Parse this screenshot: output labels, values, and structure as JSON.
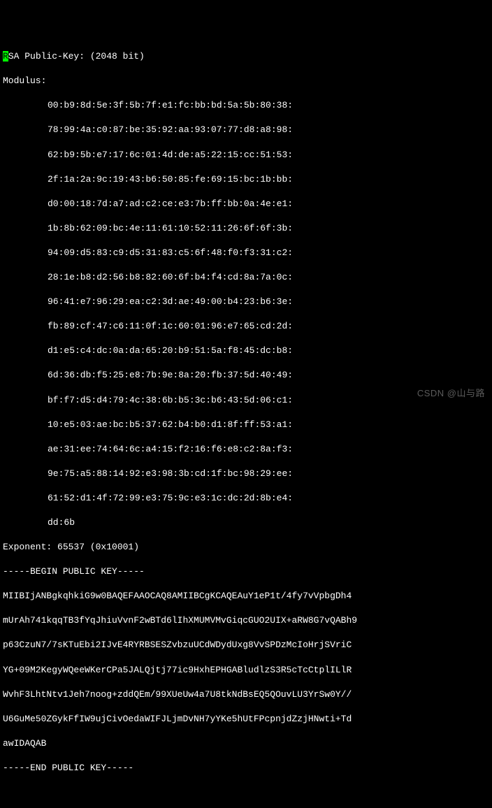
{
  "header": {
    "algo_first_char": "R",
    "algo_rest": "SA Public-Key: (2048 bit)"
  },
  "modulus_label": "Modulus:",
  "modulus_lines": [
    "00:b9:8d:5e:3f:5b:7f:e1:fc:bb:bd:5a:5b:80:38:",
    "78:99:4a:c0:87:be:35:92:aa:93:07:77:d8:a8:98:",
    "62:b9:5b:e7:17:6c:01:4d:de:a5:22:15:cc:51:53:",
    "2f:1a:2a:9c:19:43:b6:50:85:fe:69:15:bc:1b:bb:",
    "d0:00:18:7d:a7:ad:c2:ce:e3:7b:ff:bb:0a:4e:e1:",
    "1b:8b:62:09:bc:4e:11:61:10:52:11:26:6f:6f:3b:",
    "94:09:d5:83:c9:d5:31:83:c5:6f:48:f0:f3:31:c2:",
    "28:1e:b8:d2:56:b8:82:60:6f:b4:f4:cd:8a:7a:0c:",
    "96:41:e7:96:29:ea:c2:3d:ae:49:00:b4:23:b6:3e:",
    "fb:89:cf:47:c6:11:0f:1c:60:01:96:e7:65:cd:2d:",
    "d1:e5:c4:dc:0a:da:65:20:b9:51:5a:f8:45:dc:b8:",
    "6d:36:db:f5:25:e8:7b:9e:8a:20:fb:37:5d:40:49:",
    "bf:f7:d5:d4:79:4c:38:6b:b5:3c:b6:43:5d:06:c1:",
    "10:e5:03:ae:bc:b5:37:62:b4:b0:d1:8f:ff:53:a1:",
    "ae:31:ee:74:64:6c:a4:15:f2:16:f6:e8:c2:8a:f3:",
    "9e:75:a5:88:14:92:e3:98:3b:cd:1f:bc:98:29:ee:",
    "61:52:d1:4f:72:99:e3:75:9c:e3:1c:dc:2d:8b:e4:",
    "dd:6b"
  ],
  "exponent": "Exponent: 65537 (0x10001)",
  "pem_begin": "-----BEGIN PUBLIC KEY-----",
  "pem_body": [
    "MIIBIjANBgkqhkiG9w0BAQEFAAOCAQ8AMIIBCgKCAQEAuY1eP1t/4fy7vVpbgDh4",
    "mUrAh741kqqTB3fYqJhiuVvnF2wBTd6lIhXMUMVMvGiqcGUO2UIX+aRW8G7vQABh9",
    "p63CzuN7/7sKTuEbi2IJvE4RYRBSESZvbzuUCdWDydUxg8VvSPDzMcIoHrjSVriC",
    "YG+09M2KegyWQeeWKerCPa5JALQjtj77ic9HxhEPHGABludlzS3R5cTcCtplILlR",
    "WvhF3LhtNtv1Jeh7noog+zddQEm/99XUeUw4a7U8tkNdBsEQ5QOuvLU3YrSw0Y//",
    "U6GuMe50ZGykFfIW9ujCivOedaWIFJLjmDvNH7yYKe5hUtFPcpnjdZzjHNwti+Td",
    "awIDAQAB"
  ],
  "pem_end": "-----END PUBLIC KEY-----",
  "watermark": "CSDN @山与路"
}
